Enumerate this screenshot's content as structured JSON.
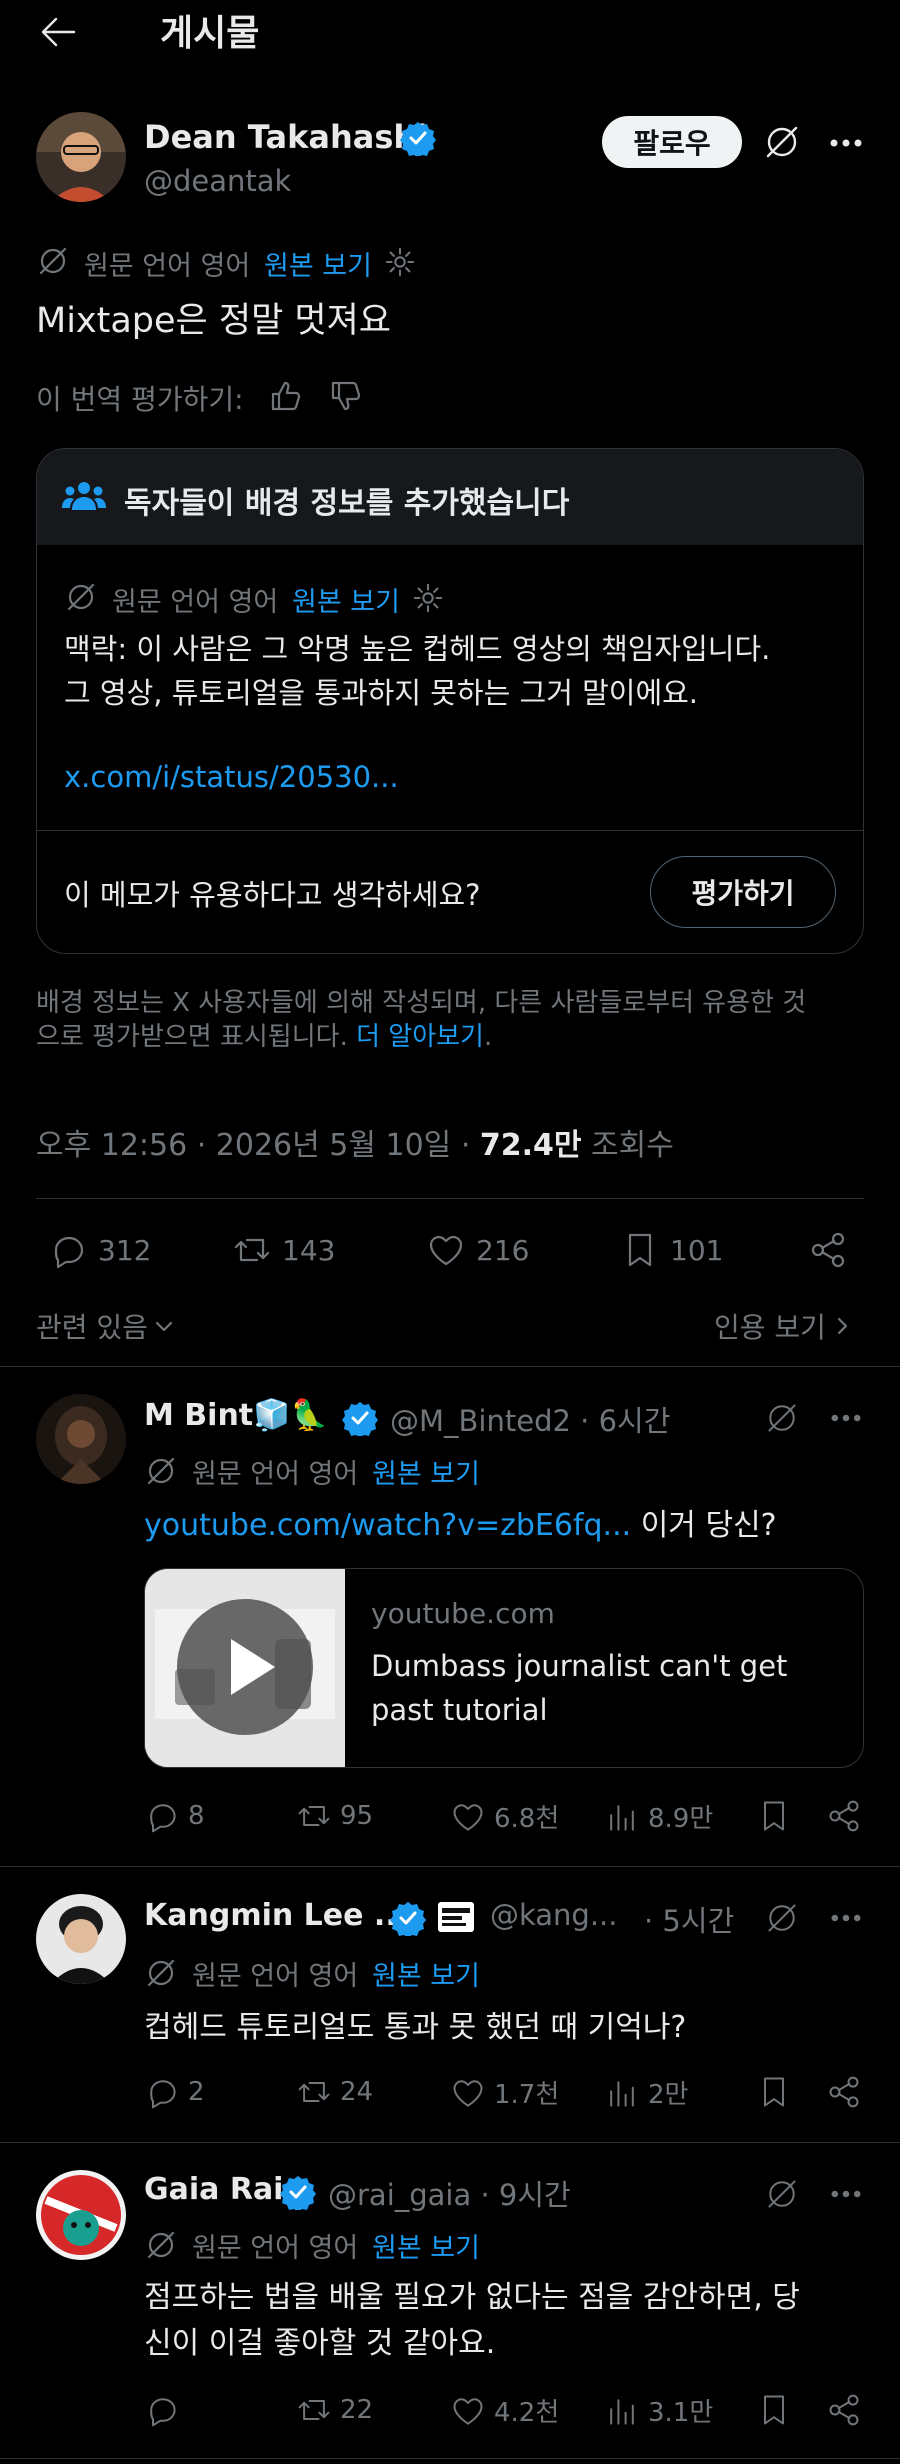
{
  "header": {
    "title": "게시물"
  },
  "post": {
    "author_name": "Dean Takahashi",
    "handle": "@deantak",
    "follow_label": "팔로우",
    "translation_prefix": "원문 언어 영어",
    "show_original": "원본 보기",
    "text": "Mixtape은 정말 멋져요",
    "rate_translation": "이 번역 평가하기:",
    "timestamp": "오후 12:56 · 2026년 5월 10일 · ",
    "views_count": "72.4만",
    "views_label": " 조회수",
    "stats": {
      "replies": "312",
      "reposts": "143",
      "likes": "216",
      "bookmarks": "101"
    },
    "related": "관련 있음",
    "view_quotes": "인용 보기"
  },
  "note": {
    "header": "독자들이 배경 정보를 추가했습니다",
    "translation_prefix": "원문 언어 영어",
    "show_original": "원본 보기",
    "text_line1": "맥락: 이 사람은 그 악명 높은 컵헤드 영상의 책임자입니다.",
    "text_line2": "그 영상, 튜토리얼을 통과하지 못하는 그거 말이에요.",
    "link": "x.com/i/status/20530...",
    "question": "이 메모가 유용하다고 생각하세요?",
    "rate_button": "평가하기"
  },
  "disclaimer": {
    "line1": "배경 정보는 X 사용자들에 의해 작성되며, 다른 사람들로부터 유용한 것",
    "line2": "으로 평가받으면 표시됩니다.",
    "learn_more": "더 알아보기",
    "period": "."
  },
  "replies": [
    {
      "name": "M Bint🧊🦜",
      "handle": "@M_Binted2",
      "time": "· 6시간",
      "translation_prefix": "원문 언어 영어",
      "show_original": "원본 보기",
      "link": "youtube.com/watch?v=zbE6fq...",
      "text": " 이거 당신?",
      "card_domain": "youtube.com",
      "card_title_1": "Dumbass journalist can't get",
      "card_title_2": "past tutorial",
      "stats": {
        "replies": "8",
        "reposts": "95",
        "likes": "6.8천",
        "views": "8.9만"
      }
    },
    {
      "name": "Kangmin Lee ...",
      "handle": "@kang...",
      "time": "· 5시간",
      "translation_prefix": "원문 언어 영어",
      "show_original": "원본 보기",
      "text": "컵헤드 튜토리얼도 통과 못 했던 때 기억나?",
      "stats": {
        "replies": "2",
        "reposts": "24",
        "likes": "1.7천",
        "views": "2만"
      }
    },
    {
      "name": "Gaia Rai",
      "handle": "@rai_gaia",
      "time": "· 9시간",
      "translation_prefix": "원문 언어 영어",
      "show_original": "원본 보기",
      "text_line1": "점프하는 법을 배울 필요가 없다는 점을 감안하면, 당",
      "text_line2": "신이 이걸 좋아할 것 같아요.",
      "stats": {
        "replies": "",
        "reposts": "22",
        "likes": "4.2천",
        "views": "3.1만"
      }
    }
  ],
  "colors": {
    "accent": "#1d9bf0",
    "background": "#000000",
    "text": "#e7e9ea",
    "muted": "#71767b",
    "border": "#2f3336"
  }
}
